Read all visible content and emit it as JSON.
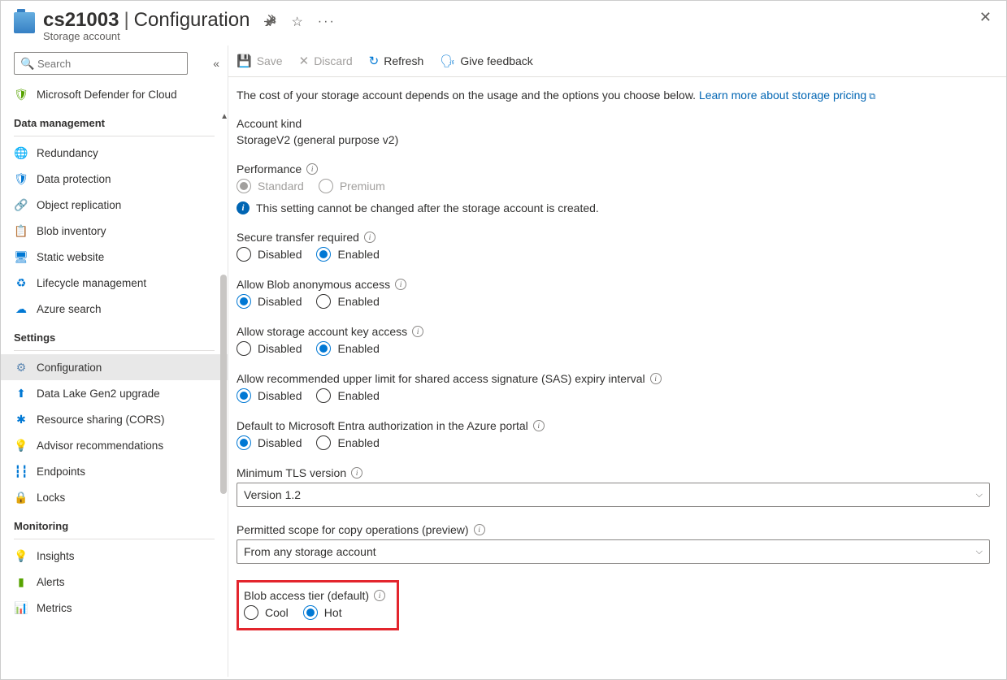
{
  "header": {
    "resource_name": "cs21003",
    "blade_name": "Configuration",
    "resource_type": "Storage account"
  },
  "search": {
    "placeholder": "Search"
  },
  "nav": {
    "top_item": "Microsoft Defender for Cloud",
    "sections": [
      {
        "title": "Data management",
        "items": [
          "Redundancy",
          "Data protection",
          "Object replication",
          "Blob inventory",
          "Static website",
          "Lifecycle management",
          "Azure search"
        ]
      },
      {
        "title": "Settings",
        "items": [
          "Configuration",
          "Data Lake Gen2 upgrade",
          "Resource sharing (CORS)",
          "Advisor recommendations",
          "Endpoints",
          "Locks"
        ]
      },
      {
        "title": "Monitoring",
        "items": [
          "Insights",
          "Alerts",
          "Metrics"
        ]
      }
    ]
  },
  "toolbar": {
    "save": "Save",
    "discard": "Discard",
    "refresh": "Refresh",
    "feedback": "Give feedback"
  },
  "content": {
    "desc": "The cost of your storage account depends on the usage and the options you choose below.",
    "learn_more": "Learn more about storage pricing",
    "account_kind_label": "Account kind",
    "account_kind_value": "StorageV2 (general purpose v2)",
    "performance_label": "Performance",
    "standard": "Standard",
    "premium": "Premium",
    "perf_msg": "This setting cannot be changed after the storage account is created.",
    "disabled": "Disabled",
    "enabled": "Enabled",
    "secure_transfer": "Secure transfer required",
    "anon_access": "Allow Blob anonymous access",
    "key_access": "Allow storage account key access",
    "sas_expiry": "Allow recommended upper limit for shared access signature (SAS) expiry interval",
    "entra_auth": "Default to Microsoft Entra authorization in the Azure portal",
    "tls_label": "Minimum TLS version",
    "tls_value": "Version 1.2",
    "copy_scope_label": "Permitted scope for copy operations (preview)",
    "copy_scope_value": "From any storage account",
    "blob_tier_label": "Blob access tier (default)",
    "cool": "Cool",
    "hot": "Hot"
  }
}
